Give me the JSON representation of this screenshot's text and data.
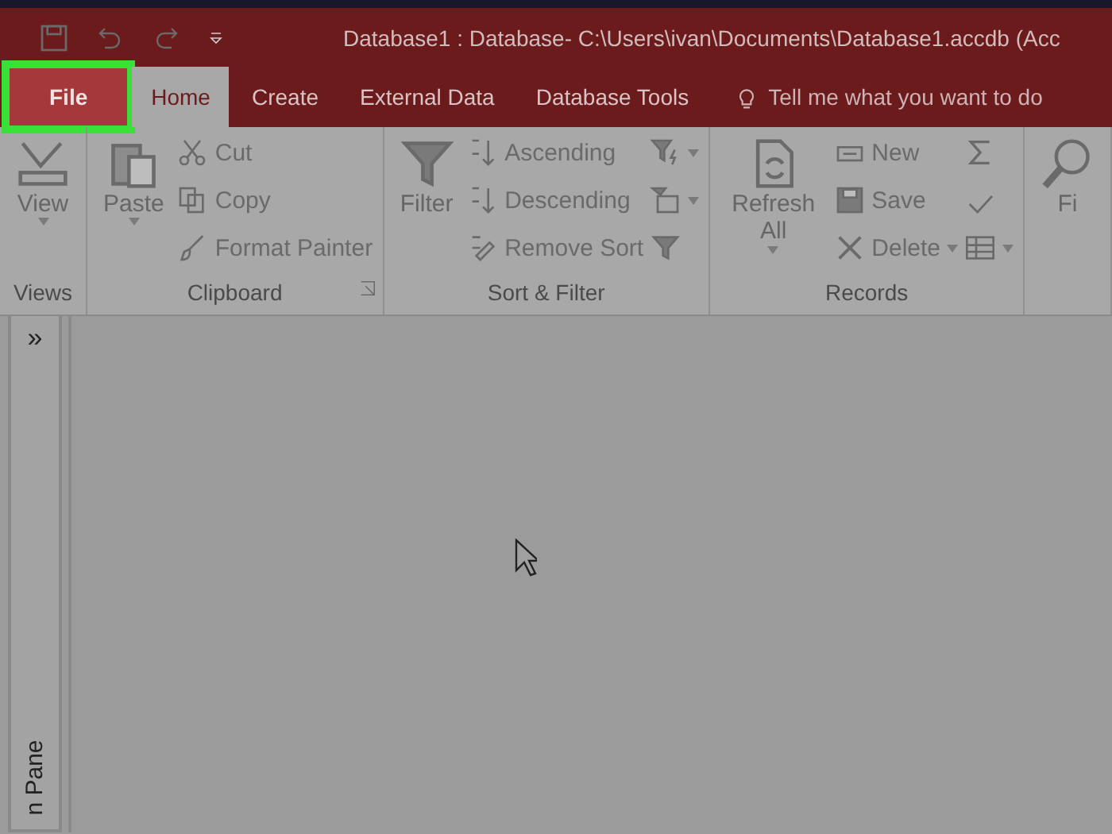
{
  "window": {
    "title": "Database1 : Database- C:\\Users\\ivan\\Documents\\Database1.accdb (Acc"
  },
  "tabs": [
    {
      "label": "File",
      "kind": "file",
      "selected": false,
      "highlighted": true
    },
    {
      "label": "Home",
      "kind": "tab",
      "selected": true,
      "highlighted": false
    },
    {
      "label": "Create",
      "kind": "tab",
      "selected": false,
      "highlighted": false
    },
    {
      "label": "External Data",
      "kind": "tab",
      "selected": false,
      "highlighted": false
    },
    {
      "label": "Database Tools",
      "kind": "tab",
      "selected": false,
      "highlighted": false
    }
  ],
  "tell_me": {
    "placeholder": "Tell me what you want to do"
  },
  "ribbon": {
    "groups": [
      {
        "label": "Views",
        "launcher": false,
        "items": [
          {
            "label": "View",
            "kind": "large",
            "dropdown": true
          }
        ]
      },
      {
        "label": "Clipboard",
        "launcher": true,
        "items": [
          {
            "label": "Paste",
            "kind": "large",
            "dropdown": true
          },
          {
            "label": "Cut",
            "kind": "small",
            "dropdown": false
          },
          {
            "label": "Copy",
            "kind": "small",
            "dropdown": false
          },
          {
            "label": "Format Painter",
            "kind": "small",
            "dropdown": false
          }
        ]
      },
      {
        "label": "Sort & Filter",
        "launcher": false,
        "items": [
          {
            "label": "Filter",
            "kind": "large",
            "dropdown": false
          },
          {
            "label": "Ascending",
            "kind": "small",
            "dropdown": false
          },
          {
            "label": "Descending",
            "kind": "small",
            "dropdown": false
          },
          {
            "label": "Remove Sort",
            "kind": "small",
            "dropdown": false
          },
          {
            "kind": "icon",
            "dropdown": true
          },
          {
            "kind": "icon",
            "dropdown": true
          },
          {
            "kind": "icon",
            "dropdown": false
          }
        ]
      },
      {
        "label": "Records",
        "launcher": false,
        "items": [
          {
            "label": "Refresh All",
            "kind": "large",
            "dropdown": true
          },
          {
            "label": "New",
            "kind": "small",
            "dropdown": false
          },
          {
            "label": "Save",
            "kind": "small",
            "dropdown": false
          },
          {
            "label": "Delete",
            "kind": "small",
            "dropdown": true
          },
          {
            "kind": "icon",
            "dropdown": false
          },
          {
            "kind": "icon",
            "dropdown": false
          },
          {
            "kind": "icon",
            "dropdown": true
          }
        ]
      },
      {
        "launcher": false,
        "items": [
          {
            "label": "Fi",
            "kind": "large",
            "dropdown": false
          }
        ]
      }
    ]
  },
  "nav_pane": {
    "toggle": "»",
    "label": "n Pane"
  }
}
